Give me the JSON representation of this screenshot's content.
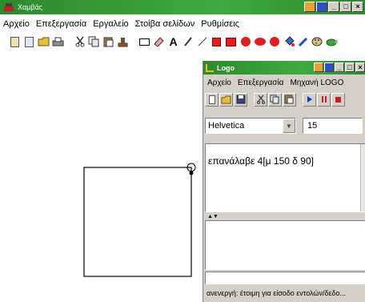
{
  "main_window": {
    "title": "Χαμβάς",
    "controls": [
      "_",
      "□",
      "×"
    ],
    "menu": [
      "Αρχείο",
      "Επεξεργασία",
      "Εργαλείο",
      "Στοίβα σελίδων",
      "Ρυθμίσεις"
    ],
    "toolbar_icons": [
      "new-page-icon",
      "copy-page-icon",
      "open-folder-icon",
      "print-icon",
      "cut-icon",
      "copy-icon",
      "paste-icon",
      "stamp-icon",
      "rectangle-tool-icon",
      "eraser-icon",
      "text-tool-icon",
      "pencil-icon",
      "line-tool-icon",
      "filled-rectangle-icon",
      "filled-square-icon",
      "filled-circle-icon",
      "filled-ellipse-icon",
      "filled-oval-icon",
      "fill-bucket-icon",
      "pen-color-icon",
      "palette-icon",
      "turtle-icon"
    ]
  },
  "logo_window": {
    "title": "Logo",
    "controls": [
      "_",
      "□",
      "×"
    ],
    "menu": [
      "Αρχείο",
      "Επεξεργασία",
      "Μηχανή LOGO"
    ],
    "toolbar_icons": [
      "new-doc-icon",
      "open-folder-icon",
      "save-icon",
      "cut-icon",
      "copy-icon",
      "paste-icon",
      "run-icon",
      "pause-icon",
      "stop-icon"
    ],
    "font_name": "Helvetica",
    "font_size": "15",
    "command_text": "επανάλαβε 4[μ 150 δ 90]",
    "status": "ανενεργή: έτοιμη για είσοδο εντολών/δεδο..."
  },
  "colors": {
    "titlebar": "#3a9a3a",
    "window_face": "#d4d0c8",
    "accent_red": "#e02020"
  }
}
